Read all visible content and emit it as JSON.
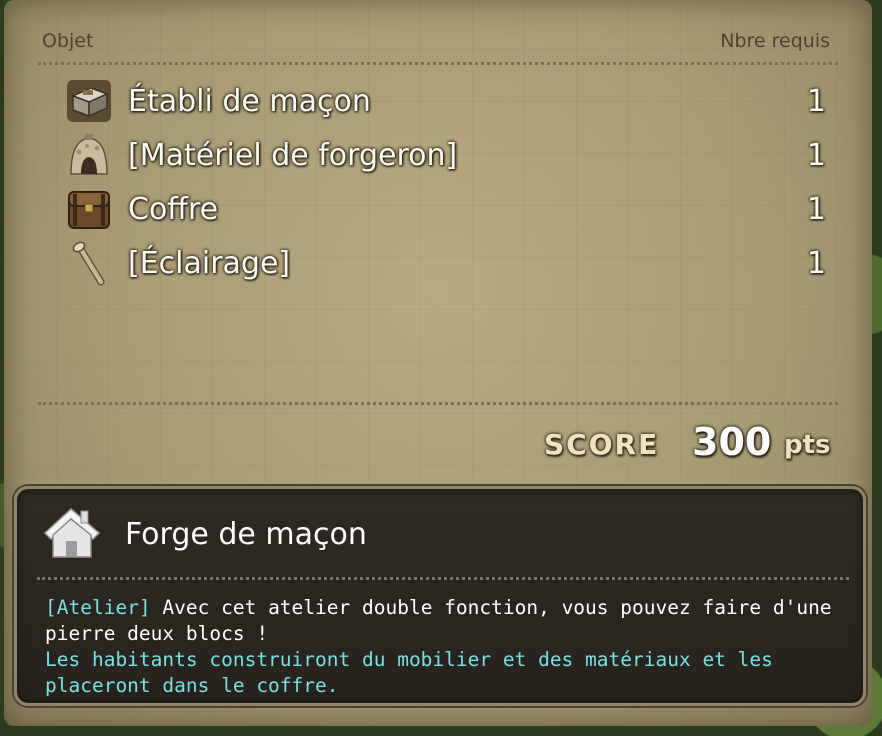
{
  "headers": {
    "item": "Objet",
    "required": "Nbre requis"
  },
  "items": [
    {
      "icon": "workbench-icon",
      "name": "Établi de maçon",
      "count": "1"
    },
    {
      "icon": "forge-icon",
      "name": "[Matériel de forgeron]",
      "count": "1"
    },
    {
      "icon": "chest-icon",
      "name": "Coffre",
      "count": "1"
    },
    {
      "icon": "torch-icon",
      "name": "[Éclairage]",
      "count": "1"
    }
  ],
  "score": {
    "label": "SCORE",
    "value": "300",
    "unit": "pts"
  },
  "description": {
    "icon": "house-icon",
    "title": "Forge de maçon",
    "tag": "[Atelier]",
    "line1": " Avec cet atelier double fonction, vous pouvez faire d'une",
    "line2": "pierre deux blocs !",
    "line3": "Les habitants construiront du mobilier et des matériaux et les",
    "line4": "placeront dans le coffre."
  },
  "colors": {
    "parchment": "#a89a73",
    "panel": "#2b2720",
    "accent_cyan": "#6fe3e6"
  }
}
